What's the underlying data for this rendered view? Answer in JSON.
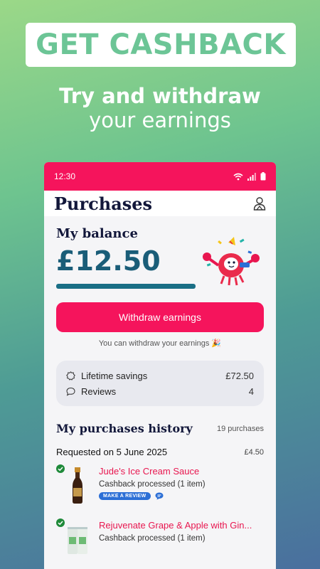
{
  "promo": {
    "banner_text": "GET CASHBACK",
    "headline_line1": "Try and withdraw",
    "headline_line2": "your earnings"
  },
  "status_bar": {
    "time": "12:30"
  },
  "app": {
    "title": "Purchases"
  },
  "balance": {
    "title": "My balance",
    "amount": "£12.50",
    "progress_percent": 100
  },
  "withdraw": {
    "button_label": "Withdraw earnings",
    "note": "You can withdraw your earnings 🎉"
  },
  "stats": [
    {
      "label": "Lifetime savings",
      "value": "£72.50",
      "icon": "savings-badge-icon"
    },
    {
      "label": "Reviews",
      "value": "4",
      "icon": "speech-bubble-icon"
    }
  ],
  "history": {
    "title": "My purchases history",
    "count": "19 purchases",
    "orders": [
      {
        "requested": "Requested on 5 June 2025",
        "total": "£4.50",
        "items": [
          {
            "name": "Jude's Ice Cream Sauce",
            "status": "Cashback processed (1 item)",
            "review_label": "MAKE A REVIEW"
          },
          {
            "name": "Rejuvenate Grape & Apple with Gin...",
            "status": "Cashback processed (1 item)"
          }
        ]
      }
    ]
  },
  "colors": {
    "brand_pink": "#f5145c",
    "balance_teal": "#1a5d78",
    "promo_green": "#6cc596",
    "review_blue": "#2c6fd6"
  }
}
